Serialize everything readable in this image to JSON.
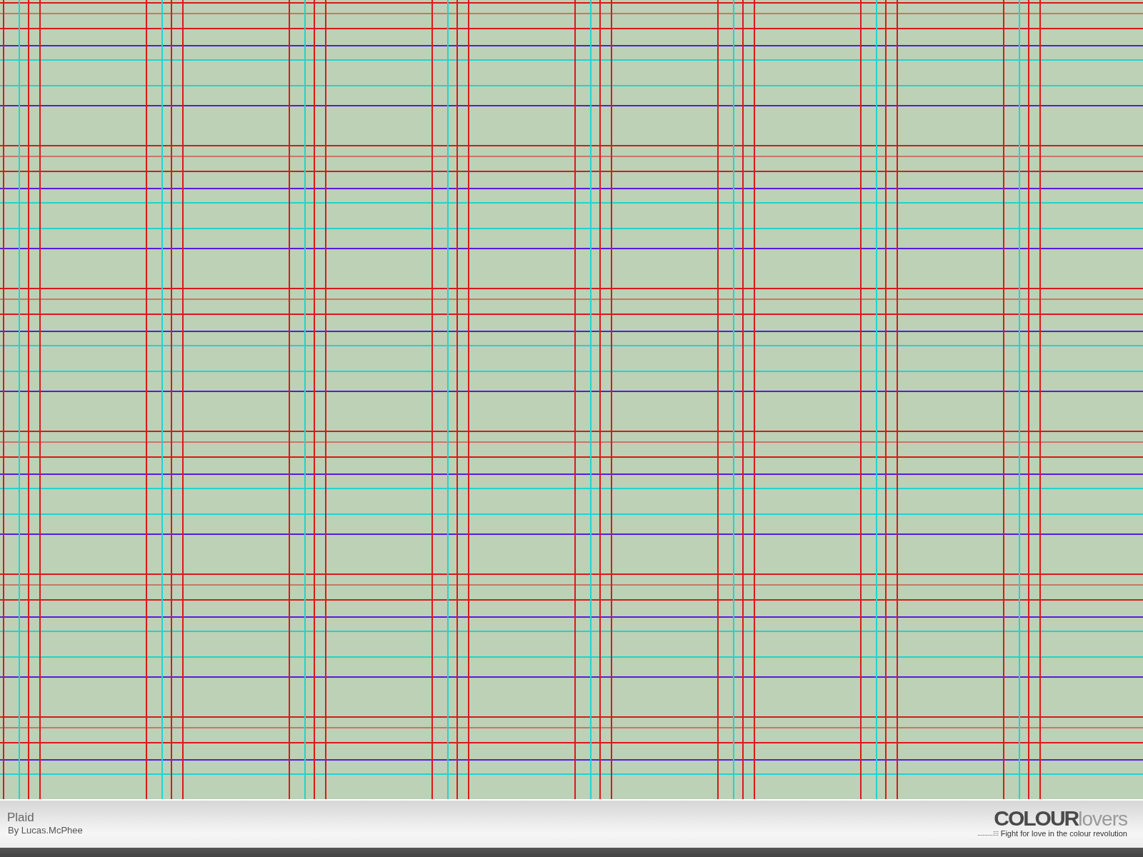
{
  "pattern": {
    "title": "Plaid",
    "author": "By Lucas.McPhee"
  },
  "logo": {
    "strong": "COLOUR",
    "light": "lovers",
    "tagline": "Fight for love in the colour revolution"
  }
}
